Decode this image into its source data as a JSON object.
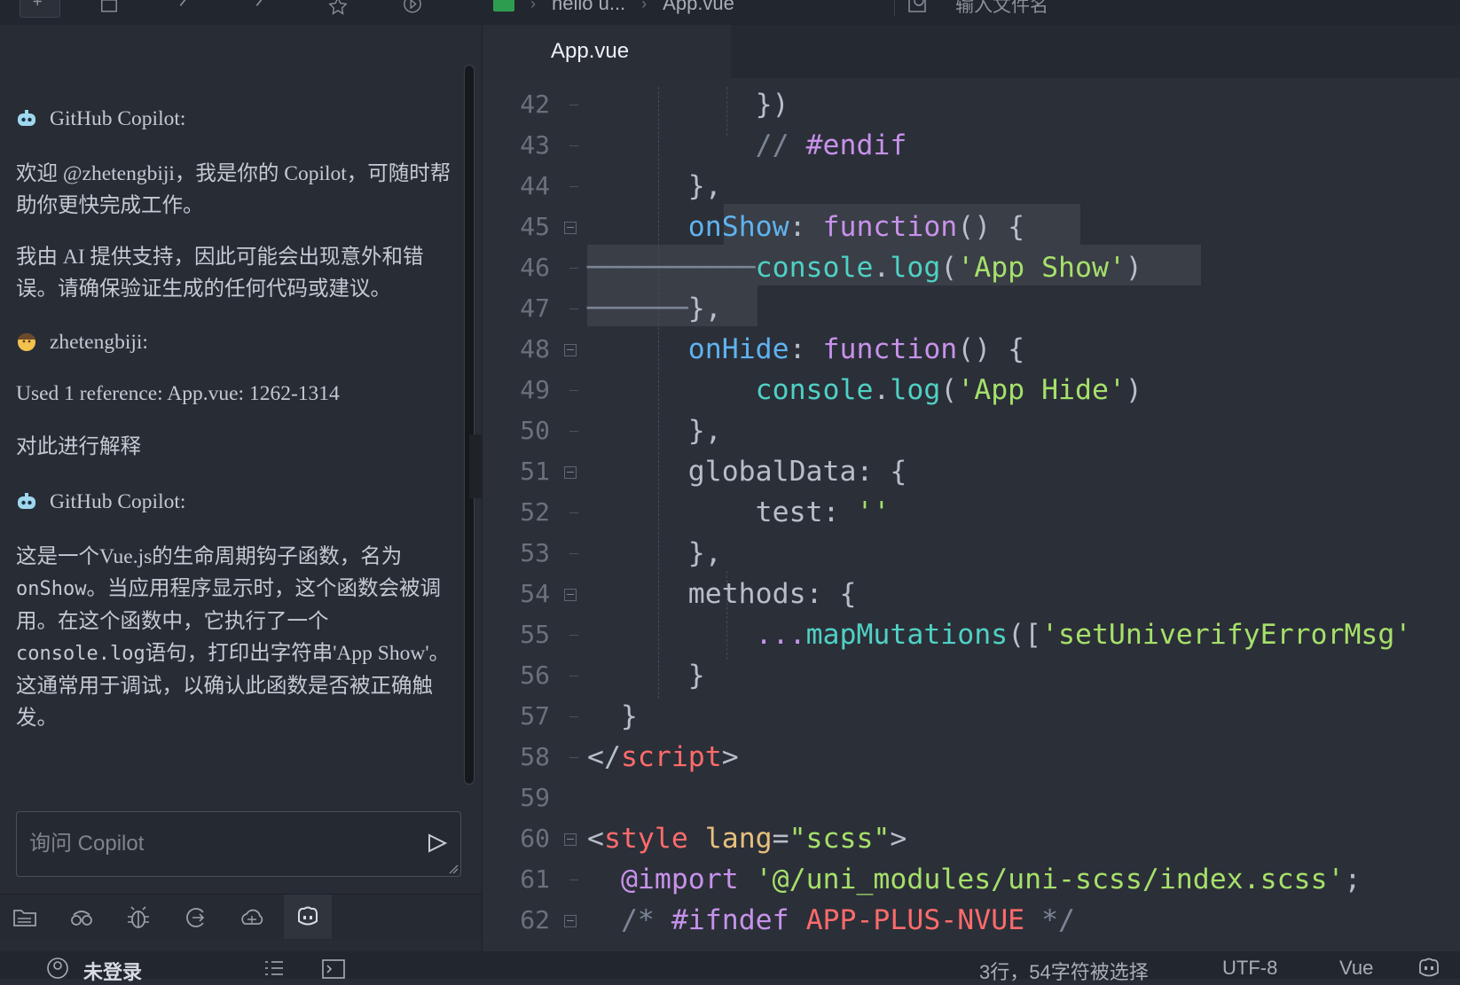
{
  "topbar": {
    "breadcrumb": [
      "hello u...",
      "App.vue"
    ],
    "search_placeholder": "输入文件名"
  },
  "editor": {
    "tab_label": "App.vue",
    "lines": [
      {
        "n": "42"
      },
      {
        "n": "43"
      },
      {
        "n": "44"
      },
      {
        "n": "45"
      },
      {
        "n": "46"
      },
      {
        "n": "47"
      },
      {
        "n": "48"
      },
      {
        "n": "49"
      },
      {
        "n": "50"
      },
      {
        "n": "51"
      },
      {
        "n": "52"
      },
      {
        "n": "53"
      },
      {
        "n": "54"
      },
      {
        "n": "55"
      },
      {
        "n": "56"
      },
      {
        "n": "57"
      },
      {
        "n": "58"
      },
      {
        "n": "59"
      },
      {
        "n": "60"
      },
      {
        "n": "61"
      },
      {
        "n": "62"
      }
    ]
  },
  "copilot": {
    "messages": [
      {
        "author": "GitHub Copilot:"
      },
      {
        "text": "欢迎 @zhetengbiji，我是你的 Copilot，可随时帮助你更快完成工作。"
      },
      {
        "text": "我由 AI 提供支持，因此可能会出现意外和错误。请确保验证生成的任何代码或建议。"
      },
      {
        "author": "zhetengbiji:"
      },
      {
        "text": "Used 1 reference: App.vue: 1262-1314"
      },
      {
        "text": "对此进行解释"
      },
      {
        "author": "GitHub Copilot:"
      },
      {
        "text_a": "这是一个Vue.js的生命周期钩子函数，名为",
        "code_a": "onShow",
        "text_b": "。当应用程序显示时，这个函数会被调用。在这个函数中，它执行了一个",
        "code_b": "console.log",
        "text_c": "语句，打印出字符串'App Show'。这通常用于调试，以确认此函数是否被正确触发。"
      }
    ],
    "ask_placeholder": "询问 Copilot"
  },
  "status": {
    "login": "未登录",
    "selection": "3行，54字符被选择",
    "encoding": "UTF-8",
    "language": "Vue"
  }
}
